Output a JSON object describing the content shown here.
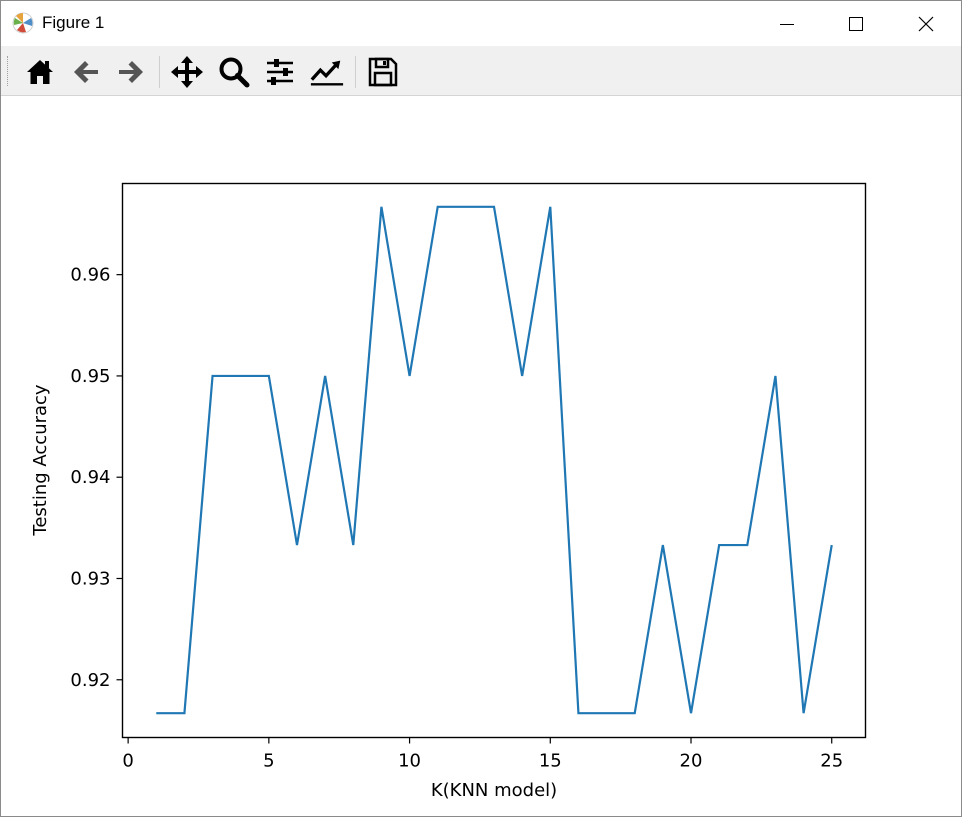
{
  "window": {
    "title": "Figure 1"
  },
  "toolbar": {
    "buttons": [
      {
        "name": "home-icon"
      },
      {
        "name": "back-arrow-icon"
      },
      {
        "name": "forward-arrow-icon"
      },
      {
        "name": "pan-move-icon"
      },
      {
        "name": "zoom-magnifier-icon"
      },
      {
        "name": "configure-subplots-icon"
      },
      {
        "name": "edit-axis-line-icon"
      },
      {
        "name": "save-floppy-icon"
      }
    ]
  },
  "chart_data": {
    "type": "line",
    "title": "",
    "xlabel": "K(KNN model)",
    "ylabel": "Testing Accuracy",
    "xlim": [
      -0.2,
      26.2
    ],
    "ylim": [
      0.9143,
      0.969
    ],
    "xticks": [
      0,
      5,
      10,
      15,
      20,
      25
    ],
    "yticks": [
      0.92,
      0.93,
      0.94,
      0.95,
      0.96
    ],
    "ytick_labels": [
      "0.92",
      "0.93",
      "0.94",
      "0.95",
      "0.96"
    ],
    "grid": false,
    "line_color": "#1f77b4",
    "series": [
      {
        "x": [
          1,
          2,
          3,
          4,
          5,
          6,
          7,
          8,
          9,
          10,
          11,
          12,
          13,
          14,
          15,
          16,
          17,
          18,
          19,
          20,
          21,
          22,
          23,
          24,
          25
        ],
        "values": [
          0.9167,
          0.9167,
          0.95,
          0.95,
          0.95,
          0.9333,
          0.95,
          0.9333,
          0.9667,
          0.95,
          0.9667,
          0.9667,
          0.9667,
          0.95,
          0.9667,
          0.9167,
          0.9167,
          0.9167,
          0.9333,
          0.9167,
          0.9333,
          0.9333,
          0.95,
          0.9167,
          0.9333
        ]
      }
    ]
  }
}
